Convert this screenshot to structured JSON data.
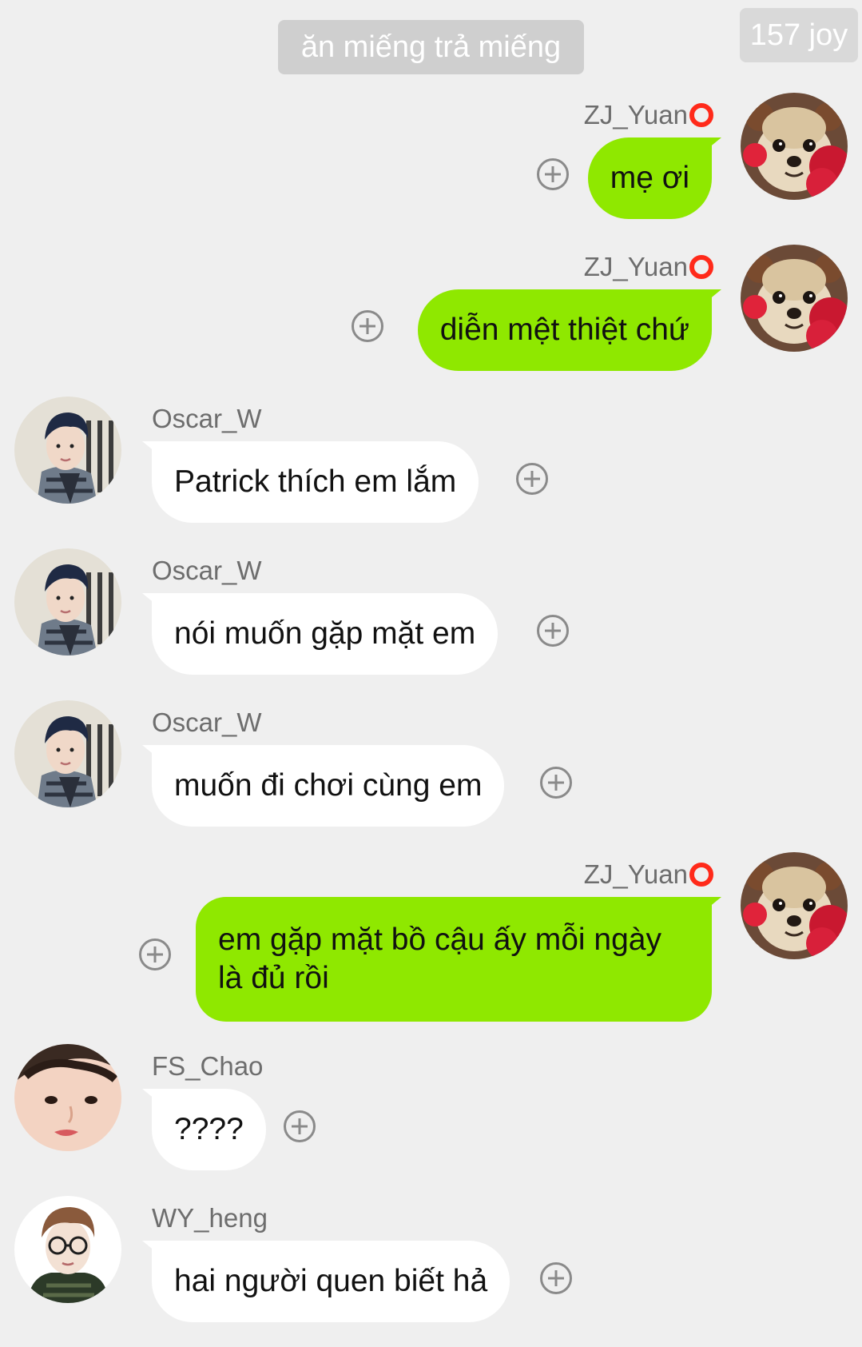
{
  "header": {
    "title": "ăn miếng trả miếng",
    "joy_count": "157 joy"
  },
  "colors": {
    "background": "#efefef",
    "outgoing_bubble": "#8fe800",
    "incoming_bubble": "#ffffff",
    "status_ring": "#ff2a1a"
  },
  "messages": [
    {
      "sender": "ZJ_Yuan",
      "direction": "outgoing",
      "avatar": "chihuahua-avatar",
      "status_icon": "red-circle-icon",
      "text": "mẹ ơi"
    },
    {
      "sender": "ZJ_Yuan",
      "direction": "outgoing",
      "avatar": "chihuahua-avatar",
      "status_icon": "red-circle-icon",
      "text": "diễn mệt thiệt chứ"
    },
    {
      "sender": "Oscar_W",
      "direction": "incoming",
      "avatar": "dark-hair-plaid-avatar",
      "text": "Patrick thích em lắm"
    },
    {
      "sender": "Oscar_W",
      "direction": "incoming",
      "avatar": "dark-hair-plaid-avatar",
      "text": "nói muốn gặp mặt em"
    },
    {
      "sender": "Oscar_W",
      "direction": "incoming",
      "avatar": "dark-hair-plaid-avatar",
      "text": "muốn đi chơi cùng em"
    },
    {
      "sender": "ZJ_Yuan",
      "direction": "outgoing",
      "avatar": "chihuahua-avatar",
      "status_icon": "red-circle-icon",
      "text": "em gặp mặt bồ cậu ấy mỗi ngày là đủ rồi"
    },
    {
      "sender": "FS_Chao",
      "direction": "incoming",
      "avatar": "face-closeup-avatar",
      "text": "????"
    },
    {
      "sender": "WY_heng",
      "direction": "incoming",
      "avatar": "glasses-avatar",
      "text": "hai người quen biết hả"
    }
  ]
}
